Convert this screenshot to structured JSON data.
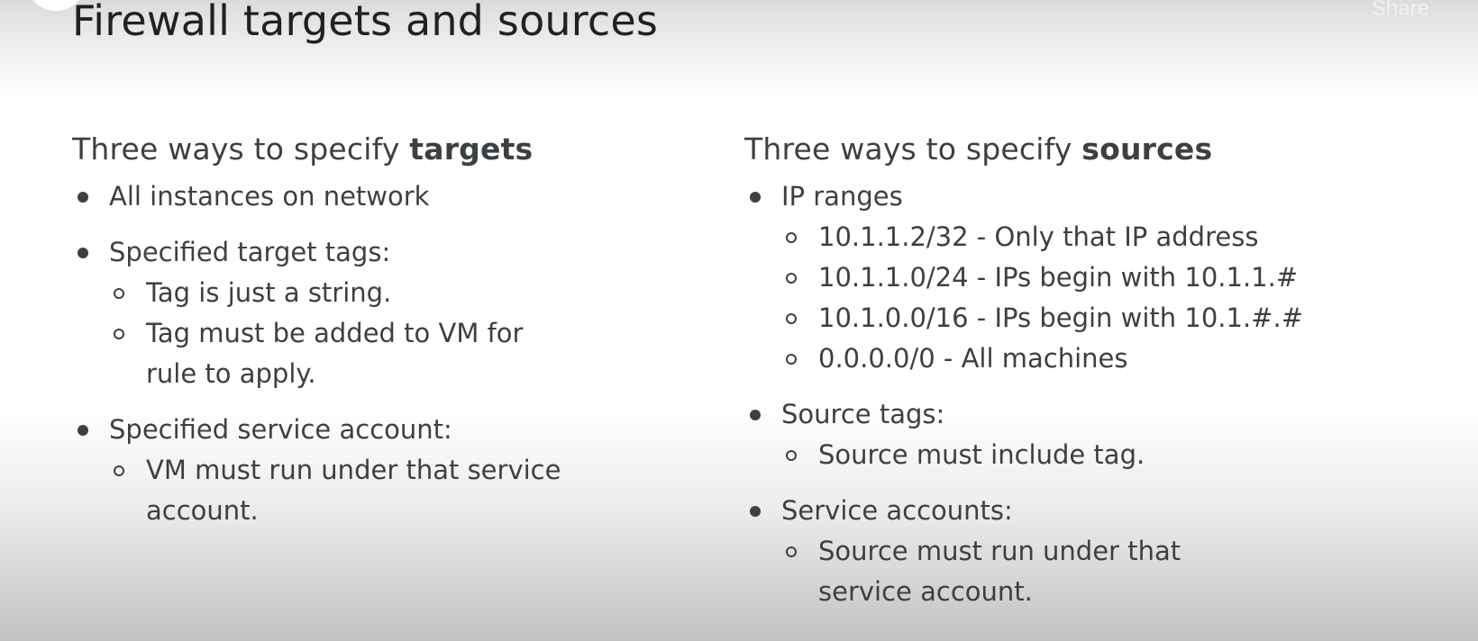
{
  "slide": {
    "title": "Firewall targets and sources"
  },
  "player": {
    "share_label": "Share"
  },
  "targets": {
    "heading_prefix": "Three ways to specify ",
    "heading_emphasis": "targets",
    "items": [
      {
        "label": "All instances on network",
        "sub": []
      },
      {
        "label": "Specified target tags:",
        "sub": [
          "Tag is just a string.",
          "Tag must be added to VM for rule to apply."
        ]
      },
      {
        "label": "Specified service account:",
        "sub": [
          "VM must run under that service account."
        ]
      }
    ]
  },
  "sources": {
    "heading_prefix": "Three ways to specify ",
    "heading_emphasis": "sources",
    "items": [
      {
        "label": "IP ranges",
        "sub": [
          "10.1.1.2/32 - Only that IP address",
          "10.1.1.0/24 - IPs begin with 10.1.1.#",
          "10.1.0.0/16 - IPs begin with 10.1.#.#",
          "0.0.0.0/0 - All machines"
        ]
      },
      {
        "label": "Source tags:",
        "sub": [
          "Source must include tag."
        ]
      },
      {
        "label": "Service accounts:",
        "sub": [
          "Source must run under that service account."
        ]
      }
    ]
  }
}
